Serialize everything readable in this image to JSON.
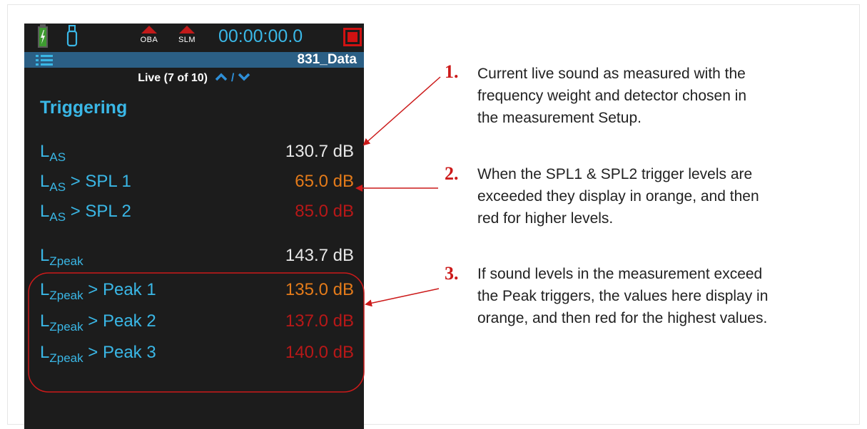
{
  "device": {
    "status": {
      "mode_oba": "OBA",
      "mode_slm": "SLM",
      "timer": "00:00:00.0"
    },
    "title": "831_Data",
    "live": {
      "label": "Live (7 of 10)",
      "up": "^",
      "separator": "/",
      "down": "v"
    },
    "section": "Triggering",
    "rows": [
      {
        "label": "L",
        "sub": "AS",
        "suffix": "",
        "value": "130.7 dB"
      },
      {
        "label": "L",
        "sub": "AS",
        "suffix": " > SPL 1",
        "value": "65.0 dB"
      },
      {
        "label": "L",
        "sub": "AS",
        "suffix": " > SPL 2",
        "value": "85.0 dB"
      },
      {
        "label": "L",
        "sub": "Zpeak",
        "suffix": "",
        "value": "143.7 dB"
      },
      {
        "label": "L",
        "sub": "Zpeak",
        "suffix": " > Peak 1",
        "value": "135.0 dB"
      },
      {
        "label": "L",
        "sub": "Zpeak",
        "suffix": " > Peak 2",
        "value": "137.0 dB"
      },
      {
        "label": "L",
        "sub": "Zpeak",
        "suffix": " > Peak 3",
        "value": "140.0 dB"
      }
    ],
    "colors": {
      "background": "#1c1c1c",
      "label_blue": "#3ab7e6",
      "title_bar": "#2b5f85",
      "value_white": "#e8e8e8",
      "value_orange": "#e47b1a",
      "value_red": "#b81818",
      "record_red": "#d01212"
    },
    "icons": [
      "battery-icon",
      "usb-icon",
      "oba-mode-icon",
      "slm-mode-icon",
      "record-stop-icon",
      "menu-list-icon",
      "chevron-up-icon",
      "chevron-down-icon"
    ]
  },
  "callouts": [
    {
      "number": "1.",
      "lines": [
        "Current live sound as measured with the",
        "frequency weight and detector chosen in",
        "the measurement Setup."
      ]
    },
    {
      "number": "2.",
      "lines": [
        "When the SPL1 & SPL2 trigger levels are",
        "exceeded they display in orange, and then",
        "red for higher levels."
      ]
    },
    {
      "number": "3.",
      "lines": [
        "If sound levels in the measurement exceed",
        "the Peak triggers, the values here display in",
        "orange, and then red for the highest values."
      ]
    }
  ],
  "annotation_color": "#cc1a1a"
}
